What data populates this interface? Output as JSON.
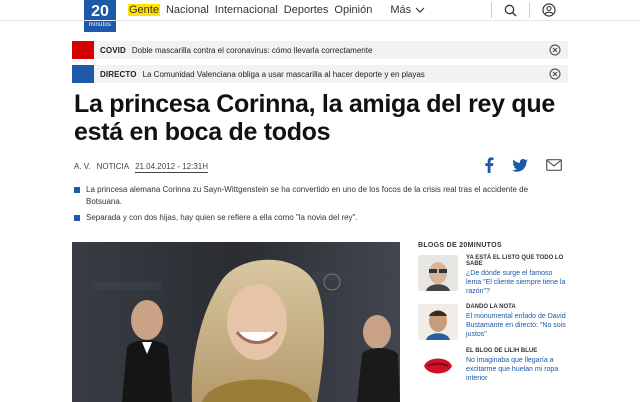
{
  "header": {
    "logo_number": "20",
    "logo_text": "minutos",
    "nav": [
      {
        "label": "Gente",
        "active": true
      },
      {
        "label": "Nacional",
        "active": false
      },
      {
        "label": "Internacional",
        "active": false
      },
      {
        "label": "Deportes",
        "active": false
      },
      {
        "label": "Opinión",
        "active": false
      }
    ],
    "more_label": "Más",
    "icons": [
      "search-icon",
      "user-icon"
    ]
  },
  "alerts": [
    {
      "tag": "COVID",
      "text": "Doble mascarilla contra el coronavirus: cómo llevarla correctamente",
      "color": "#d50000"
    },
    {
      "tag": "DIRECTO",
      "text": "La Comunidad Valenciana obliga a usar mascarilla al hacer deporte y en playas",
      "color": "#1c59a8"
    }
  ],
  "article": {
    "headline": "La princesa Corinna, la amiga del rey que está en boca de todos",
    "author": "A. V.",
    "section": "NOTICIA",
    "date": "21.04.2012 - 12:31H",
    "summary": [
      "La princesa alemana Corinna zu Sayn-Wittgenstein se ha convertido en uno de los focos de la crisis real tras el accidente de Botsuana.",
      "Separada y con dos hijas, hay quien se refiere a ella como \"la novia del rey\"."
    ],
    "share_icons": [
      "facebook-icon",
      "twitter-icon",
      "mail-icon"
    ]
  },
  "sidebar": {
    "title": "BLOGS DE 20MINUTOS",
    "items": [
      {
        "blog": "YA ESTÁ EL LISTO QUE TODO LO SABE",
        "link": "¿De dónde surge el famoso lema \"El cliente siempre tiene la razón\"?"
      },
      {
        "blog": "DANDO LA NOTA",
        "link": "El monumental enfado de David Bustamante en directo: \"No sois justos\""
      },
      {
        "blog": "EL BLOG DE LILIH BLUE",
        "link": "No imaginaba que llegaría a excitarme que huelan mi ropa interior"
      }
    ]
  },
  "colors": {
    "brand": "#1c59a8",
    "active_nav": "#ffe400",
    "covid": "#d50000"
  }
}
